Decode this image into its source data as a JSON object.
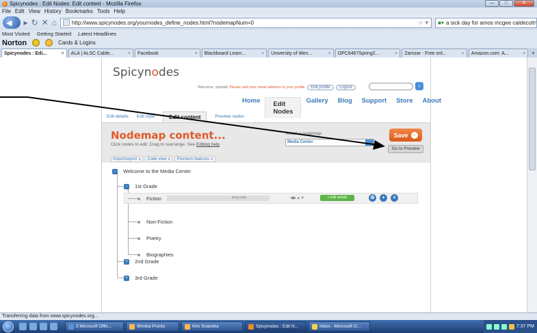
{
  "window": {
    "title": "Spicynodes : Edit Nodes: Edit content - Mozilla Firefox",
    "controls": [
      "—",
      "□",
      "X"
    ]
  },
  "menu": [
    "File",
    "Edit",
    "View",
    "History",
    "Bookmarks",
    "Tools",
    "Help"
  ],
  "nav": {
    "url": "http://www.spicynodes.org/yournodes_define_nodes.html?nodemapNum=0",
    "search": "a sick day for amos mcgee caldecott"
  },
  "bookmarks": [
    "Most Visited",
    "Getting Started",
    "Latest Headlines"
  ],
  "norton": {
    "brand": "Norton",
    "cards": "Cards & Logins"
  },
  "tabs": [
    {
      "label": "Spicynodes : Edi...",
      "active": true
    },
    {
      "label": "ALA | ALSC Calde..."
    },
    {
      "label": "Facebook"
    },
    {
      "label": "Blackboard Learn..."
    },
    {
      "label": "University of Wes..."
    },
    {
      "label": "OPC6467Spring2..."
    },
    {
      "label": "Zamzar - Free onl..."
    },
    {
      "label": "Amazon.com: A..."
    }
  ],
  "site": {
    "logo_pre": "Spicyn",
    "logo_o": "o",
    "logo_post": "des",
    "welcome": "Welcome, sphiddc",
    "warning": "Please add your email address to your profile",
    "edit_profile": "Edit profile",
    "logout": "Logout",
    "mainnav": [
      "Home",
      "Edit Nodes",
      "Gallery",
      "Blog",
      "Support",
      "Store",
      "About"
    ],
    "subnav": [
      "Edit details",
      "Edit style",
      "Edit content",
      "Preview nodes"
    ],
    "heading": "Nodemap content...",
    "subheading": "Click nodes to edit. Drag to rearrange. See",
    "help_link": "Editing help",
    "select_label": "Select a nodemap:",
    "select_value": "Media Center",
    "save": "Save",
    "preview": "Go to Preview",
    "tools": [
      "Import/export ∧",
      "Code view ∧",
      "Premium features ∧"
    ]
  },
  "tree": {
    "root": "Welcome to the Media Center",
    "grade1": "1st Grade",
    "children": [
      "Fiction",
      "Non-Fiction",
      "Poetry",
      "Biographies"
    ],
    "grade2": "2nd Grade",
    "grade3": "3rd Grade",
    "drag_label": "Drag node",
    "edit_details": "+ Edit details"
  },
  "status": "Transferring data from www.spicynodes.org...",
  "taskbar": {
    "items": [
      "3 Microsoft Offic...",
      "Wimba Pronto",
      "Kim Sciandra",
      "Spicynodes : Edit N...",
      "Inbox - Microsoft O..."
    ],
    "clock": "7:37 PM"
  }
}
